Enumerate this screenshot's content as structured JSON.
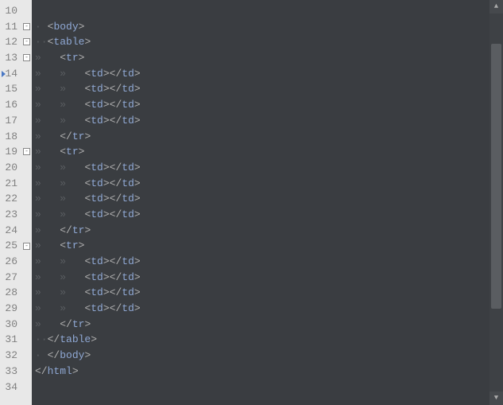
{
  "gutter": {
    "start": 10,
    "end": 34,
    "fold_markers": [
      11,
      12,
      13,
      19,
      25
    ],
    "bookmark_line": 14
  },
  "code_lines": [
    {
      "n": 10,
      "segs": []
    },
    {
      "n": 11,
      "segs": [
        {
          "t": "ws",
          "v": "·"
        },
        {
          "t": "sp",
          "v": " "
        },
        {
          "t": "punct",
          "v": "<"
        },
        {
          "t": "tag",
          "v": "body"
        },
        {
          "t": "punct",
          "v": ">"
        }
      ]
    },
    {
      "n": 12,
      "segs": [
        {
          "t": "ws",
          "v": "··"
        },
        {
          "t": "punct",
          "v": "<"
        },
        {
          "t": "tag",
          "v": "table"
        },
        {
          "t": "punct",
          "v": ">"
        }
      ]
    },
    {
      "n": 13,
      "segs": [
        {
          "t": "ws",
          "v": "»"
        },
        {
          "t": "sp",
          "v": "   "
        },
        {
          "t": "punct",
          "v": "<"
        },
        {
          "t": "tag",
          "v": "tr"
        },
        {
          "t": "punct",
          "v": ">"
        }
      ]
    },
    {
      "n": 14,
      "segs": [
        {
          "t": "ws",
          "v": "»"
        },
        {
          "t": "sp",
          "v": "   "
        },
        {
          "t": "ws",
          "v": "»"
        },
        {
          "t": "sp",
          "v": "   "
        },
        {
          "t": "punct",
          "v": "<"
        },
        {
          "t": "tag",
          "v": "td"
        },
        {
          "t": "punct",
          "v": ">"
        },
        {
          "t": "punct",
          "v": "</"
        },
        {
          "t": "tag",
          "v": "td"
        },
        {
          "t": "punct",
          "v": ">"
        }
      ]
    },
    {
      "n": 15,
      "segs": [
        {
          "t": "ws",
          "v": "»"
        },
        {
          "t": "sp",
          "v": "   "
        },
        {
          "t": "ws",
          "v": "»"
        },
        {
          "t": "sp",
          "v": "   "
        },
        {
          "t": "punct",
          "v": "<"
        },
        {
          "t": "tag",
          "v": "td"
        },
        {
          "t": "punct",
          "v": ">"
        },
        {
          "t": "punct",
          "v": "</"
        },
        {
          "t": "tag",
          "v": "td"
        },
        {
          "t": "punct",
          "v": ">"
        }
      ]
    },
    {
      "n": 16,
      "segs": [
        {
          "t": "ws",
          "v": "»"
        },
        {
          "t": "sp",
          "v": "   "
        },
        {
          "t": "ws",
          "v": "»"
        },
        {
          "t": "sp",
          "v": "   "
        },
        {
          "t": "punct",
          "v": "<"
        },
        {
          "t": "tag",
          "v": "td"
        },
        {
          "t": "punct",
          "v": ">"
        },
        {
          "t": "punct",
          "v": "</"
        },
        {
          "t": "tag",
          "v": "td"
        },
        {
          "t": "punct",
          "v": ">"
        }
      ]
    },
    {
      "n": 17,
      "segs": [
        {
          "t": "ws",
          "v": "»"
        },
        {
          "t": "sp",
          "v": "   "
        },
        {
          "t": "ws",
          "v": "»"
        },
        {
          "t": "sp",
          "v": "   "
        },
        {
          "t": "punct",
          "v": "<"
        },
        {
          "t": "tag",
          "v": "td"
        },
        {
          "t": "punct",
          "v": ">"
        },
        {
          "t": "punct",
          "v": "</"
        },
        {
          "t": "tag",
          "v": "td"
        },
        {
          "t": "punct",
          "v": ">"
        }
      ]
    },
    {
      "n": 18,
      "segs": [
        {
          "t": "ws",
          "v": "»"
        },
        {
          "t": "sp",
          "v": "   "
        },
        {
          "t": "punct",
          "v": "</"
        },
        {
          "t": "tag",
          "v": "tr"
        },
        {
          "t": "punct",
          "v": ">"
        }
      ]
    },
    {
      "n": 19,
      "segs": [
        {
          "t": "ws",
          "v": "»"
        },
        {
          "t": "sp",
          "v": "   "
        },
        {
          "t": "punct",
          "v": "<"
        },
        {
          "t": "tag",
          "v": "tr"
        },
        {
          "t": "punct",
          "v": ">"
        }
      ]
    },
    {
      "n": 20,
      "segs": [
        {
          "t": "ws",
          "v": "»"
        },
        {
          "t": "sp",
          "v": "   "
        },
        {
          "t": "ws",
          "v": "»"
        },
        {
          "t": "sp",
          "v": "   "
        },
        {
          "t": "punct",
          "v": "<"
        },
        {
          "t": "tag",
          "v": "td"
        },
        {
          "t": "punct",
          "v": ">"
        },
        {
          "t": "punct",
          "v": "</"
        },
        {
          "t": "tag",
          "v": "td"
        },
        {
          "t": "punct",
          "v": ">"
        }
      ]
    },
    {
      "n": 21,
      "segs": [
        {
          "t": "ws",
          "v": "»"
        },
        {
          "t": "sp",
          "v": "   "
        },
        {
          "t": "ws",
          "v": "»"
        },
        {
          "t": "sp",
          "v": "   "
        },
        {
          "t": "punct",
          "v": "<"
        },
        {
          "t": "tag",
          "v": "td"
        },
        {
          "t": "punct",
          "v": ">"
        },
        {
          "t": "punct",
          "v": "</"
        },
        {
          "t": "tag",
          "v": "td"
        },
        {
          "t": "punct",
          "v": ">"
        }
      ]
    },
    {
      "n": 22,
      "segs": [
        {
          "t": "ws",
          "v": "»"
        },
        {
          "t": "sp",
          "v": "   "
        },
        {
          "t": "ws",
          "v": "»"
        },
        {
          "t": "sp",
          "v": "   "
        },
        {
          "t": "punct",
          "v": "<"
        },
        {
          "t": "tag",
          "v": "td"
        },
        {
          "t": "punct",
          "v": ">"
        },
        {
          "t": "punct",
          "v": "</"
        },
        {
          "t": "tag",
          "v": "td"
        },
        {
          "t": "punct",
          "v": ">"
        }
      ]
    },
    {
      "n": 23,
      "segs": [
        {
          "t": "ws",
          "v": "»"
        },
        {
          "t": "sp",
          "v": "   "
        },
        {
          "t": "ws",
          "v": "»"
        },
        {
          "t": "sp",
          "v": "   "
        },
        {
          "t": "punct",
          "v": "<"
        },
        {
          "t": "tag",
          "v": "td"
        },
        {
          "t": "punct",
          "v": ">"
        },
        {
          "t": "punct",
          "v": "</"
        },
        {
          "t": "tag",
          "v": "td"
        },
        {
          "t": "punct",
          "v": ">"
        }
      ]
    },
    {
      "n": 24,
      "segs": [
        {
          "t": "ws",
          "v": "»"
        },
        {
          "t": "sp",
          "v": "   "
        },
        {
          "t": "punct",
          "v": "</"
        },
        {
          "t": "tag",
          "v": "tr"
        },
        {
          "t": "punct",
          "v": ">"
        }
      ]
    },
    {
      "n": 25,
      "segs": [
        {
          "t": "ws",
          "v": "»"
        },
        {
          "t": "sp",
          "v": "   "
        },
        {
          "t": "punct",
          "v": "<"
        },
        {
          "t": "tag",
          "v": "tr"
        },
        {
          "t": "punct",
          "v": ">"
        }
      ]
    },
    {
      "n": 26,
      "segs": [
        {
          "t": "ws",
          "v": "»"
        },
        {
          "t": "sp",
          "v": "   "
        },
        {
          "t": "ws",
          "v": "»"
        },
        {
          "t": "sp",
          "v": "   "
        },
        {
          "t": "punct",
          "v": "<"
        },
        {
          "t": "tag",
          "v": "td"
        },
        {
          "t": "punct",
          "v": ">"
        },
        {
          "t": "punct",
          "v": "</"
        },
        {
          "t": "tag",
          "v": "td"
        },
        {
          "t": "punct",
          "v": ">"
        }
      ]
    },
    {
      "n": 27,
      "segs": [
        {
          "t": "ws",
          "v": "»"
        },
        {
          "t": "sp",
          "v": "   "
        },
        {
          "t": "ws",
          "v": "»"
        },
        {
          "t": "sp",
          "v": "   "
        },
        {
          "t": "punct",
          "v": "<"
        },
        {
          "t": "tag",
          "v": "td"
        },
        {
          "t": "punct",
          "v": ">"
        },
        {
          "t": "punct",
          "v": "</"
        },
        {
          "t": "tag",
          "v": "td"
        },
        {
          "t": "punct",
          "v": ">"
        }
      ]
    },
    {
      "n": 28,
      "segs": [
        {
          "t": "ws",
          "v": "»"
        },
        {
          "t": "sp",
          "v": "   "
        },
        {
          "t": "ws",
          "v": "»"
        },
        {
          "t": "sp",
          "v": "   "
        },
        {
          "t": "punct",
          "v": "<"
        },
        {
          "t": "tag",
          "v": "td"
        },
        {
          "t": "punct",
          "v": ">"
        },
        {
          "t": "punct",
          "v": "</"
        },
        {
          "t": "tag",
          "v": "td"
        },
        {
          "t": "punct",
          "v": ">"
        }
      ]
    },
    {
      "n": 29,
      "segs": [
        {
          "t": "ws",
          "v": "»"
        },
        {
          "t": "sp",
          "v": "   "
        },
        {
          "t": "ws",
          "v": "»"
        },
        {
          "t": "sp",
          "v": "   "
        },
        {
          "t": "punct",
          "v": "<"
        },
        {
          "t": "tag",
          "v": "td"
        },
        {
          "t": "punct",
          "v": ">"
        },
        {
          "t": "punct",
          "v": "</"
        },
        {
          "t": "tag",
          "v": "td"
        },
        {
          "t": "punct",
          "v": ">"
        }
      ]
    },
    {
      "n": 30,
      "segs": [
        {
          "t": "ws",
          "v": "»"
        },
        {
          "t": "sp",
          "v": "   "
        },
        {
          "t": "punct",
          "v": "</"
        },
        {
          "t": "tag",
          "v": "tr"
        },
        {
          "t": "punct",
          "v": ">"
        }
      ]
    },
    {
      "n": 31,
      "segs": [
        {
          "t": "ws",
          "v": "··"
        },
        {
          "t": "punct",
          "v": "</"
        },
        {
          "t": "tag",
          "v": "table"
        },
        {
          "t": "punct",
          "v": ">"
        }
      ]
    },
    {
      "n": 32,
      "segs": [
        {
          "t": "ws",
          "v": "·"
        },
        {
          "t": "sp",
          "v": " "
        },
        {
          "t": "punct",
          "v": "</"
        },
        {
          "t": "tag",
          "v": "body"
        },
        {
          "t": "punct",
          "v": ">"
        }
      ]
    },
    {
      "n": 33,
      "segs": [
        {
          "t": "punct",
          "v": "</"
        },
        {
          "t": "tag",
          "v": "html"
        },
        {
          "t": "punct",
          "v": ">"
        }
      ]
    },
    {
      "n": 34,
      "segs": []
    }
  ],
  "scrollbar": {
    "thumb_top_pct": 8,
    "thumb_height_pct": 70
  }
}
